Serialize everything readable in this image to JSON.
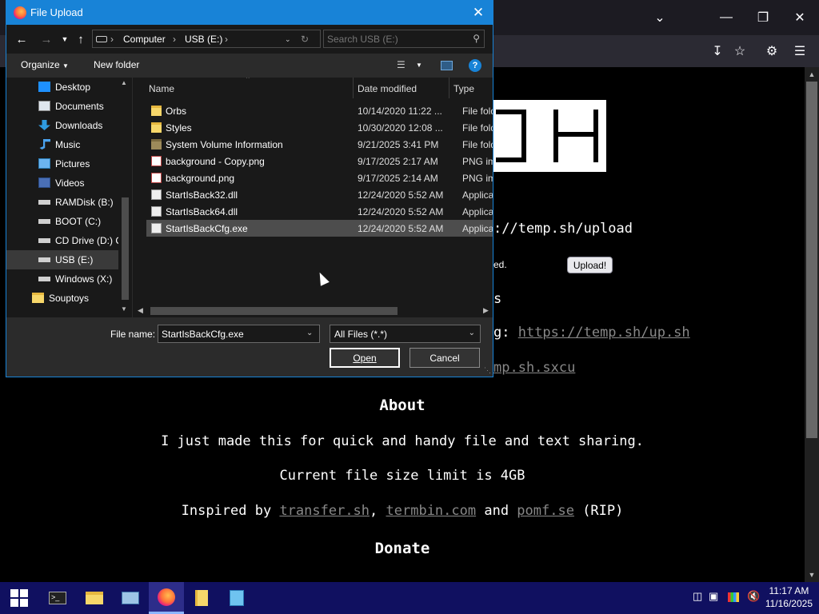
{
  "dialog": {
    "title": "File Upload",
    "address": {
      "crumbs": [
        "Computer",
        "USB (E:)"
      ]
    },
    "search_placeholder": "Search USB (E:)",
    "commands": {
      "organize": "Organize",
      "new_folder": "New folder"
    },
    "nav_items": [
      {
        "label": "Desktop",
        "icon": "desktop-icon"
      },
      {
        "label": "Documents",
        "icon": "documents-icon"
      },
      {
        "label": "Downloads",
        "icon": "downloads-icon"
      },
      {
        "label": "Music",
        "icon": "music-icon"
      },
      {
        "label": "Pictures",
        "icon": "pictures-icon"
      },
      {
        "label": "Videos",
        "icon": "videos-icon"
      },
      {
        "label": "RAMDisk (B:)",
        "icon": "drive-icon"
      },
      {
        "label": "BOOT (C:)",
        "icon": "drive-icon"
      },
      {
        "label": "CD Drive (D:) C",
        "icon": "cd-drive-icon"
      },
      {
        "label": "USB (E:)",
        "icon": "usb-drive-icon",
        "selected": true
      },
      {
        "label": "Windows (X:)",
        "icon": "drive-icon"
      },
      {
        "label": "Souptoys",
        "icon": "folder-icon"
      }
    ],
    "columns": {
      "name": "Name",
      "date": "Date modified",
      "type": "Type"
    },
    "files": [
      {
        "name": "Orbs",
        "date": "10/14/2020 11:22 ...",
        "type": "File folder",
        "icon": "folder-icon"
      },
      {
        "name": "Styles",
        "date": "10/30/2020 12:08 ...",
        "type": "File folder",
        "icon": "folder-icon"
      },
      {
        "name": "System Volume Information",
        "date": "9/21/2025 3:41 PM",
        "type": "File folder",
        "icon": "folder-icon"
      },
      {
        "name": "background - Copy.png",
        "date": "9/17/2025 2:17 AM",
        "type": "PNG imag",
        "icon": "png-file-icon"
      },
      {
        "name": "background.png",
        "date": "9/17/2025 2:14 AM",
        "type": "PNG imag",
        "icon": "png-file-icon"
      },
      {
        "name": "StartIsBack32.dll",
        "date": "12/24/2020 5:52 AM",
        "type": "Applicatio",
        "icon": "dll-file-icon"
      },
      {
        "name": "StartIsBack64.dll",
        "date": "12/24/2020 5:52 AM",
        "type": "Applicatio",
        "icon": "dll-file-icon"
      },
      {
        "name": "StartIsBackCfg.exe",
        "date": "12/24/2020 5:52 AM",
        "type": "Applicatio",
        "icon": "exe-file-icon",
        "selected": true
      }
    ],
    "file_name_label": "File name:",
    "file_name_value": "StartIsBackCfg.exe",
    "file_type": "All Files (*.*)",
    "open_label": "Open",
    "cancel_label": "Cancel"
  },
  "page": {
    "upload_url": "://temp.sh/upload",
    "upload_button": "Upload!",
    "partial_ed": "ed.",
    "partial_s": "s",
    "partial_g_prefix": "g: ",
    "upsh_link": "https://temp.sh/up.sh",
    "sxcu_link": "mp.sh.sxcu",
    "about_heading": "About",
    "about_text": "I just made this for quick and handy file and text sharing.",
    "limit_text": "Current file size limit is 4GB",
    "inspired_prefix": "Inspired by ",
    "inspired_links": [
      "transfer.sh",
      "termbin.com",
      "pomf.se"
    ],
    "inspired_sep1": ", ",
    "inspired_sep2": " and ",
    "inspired_suffix": " (RIP)",
    "donate_heading": "Donate"
  },
  "taskbar": {
    "time": "11:17 AM",
    "date": "11/16/2025"
  },
  "colors": {
    "accent": "#1883d7",
    "taskbar": "#101060",
    "link": "#888888"
  }
}
